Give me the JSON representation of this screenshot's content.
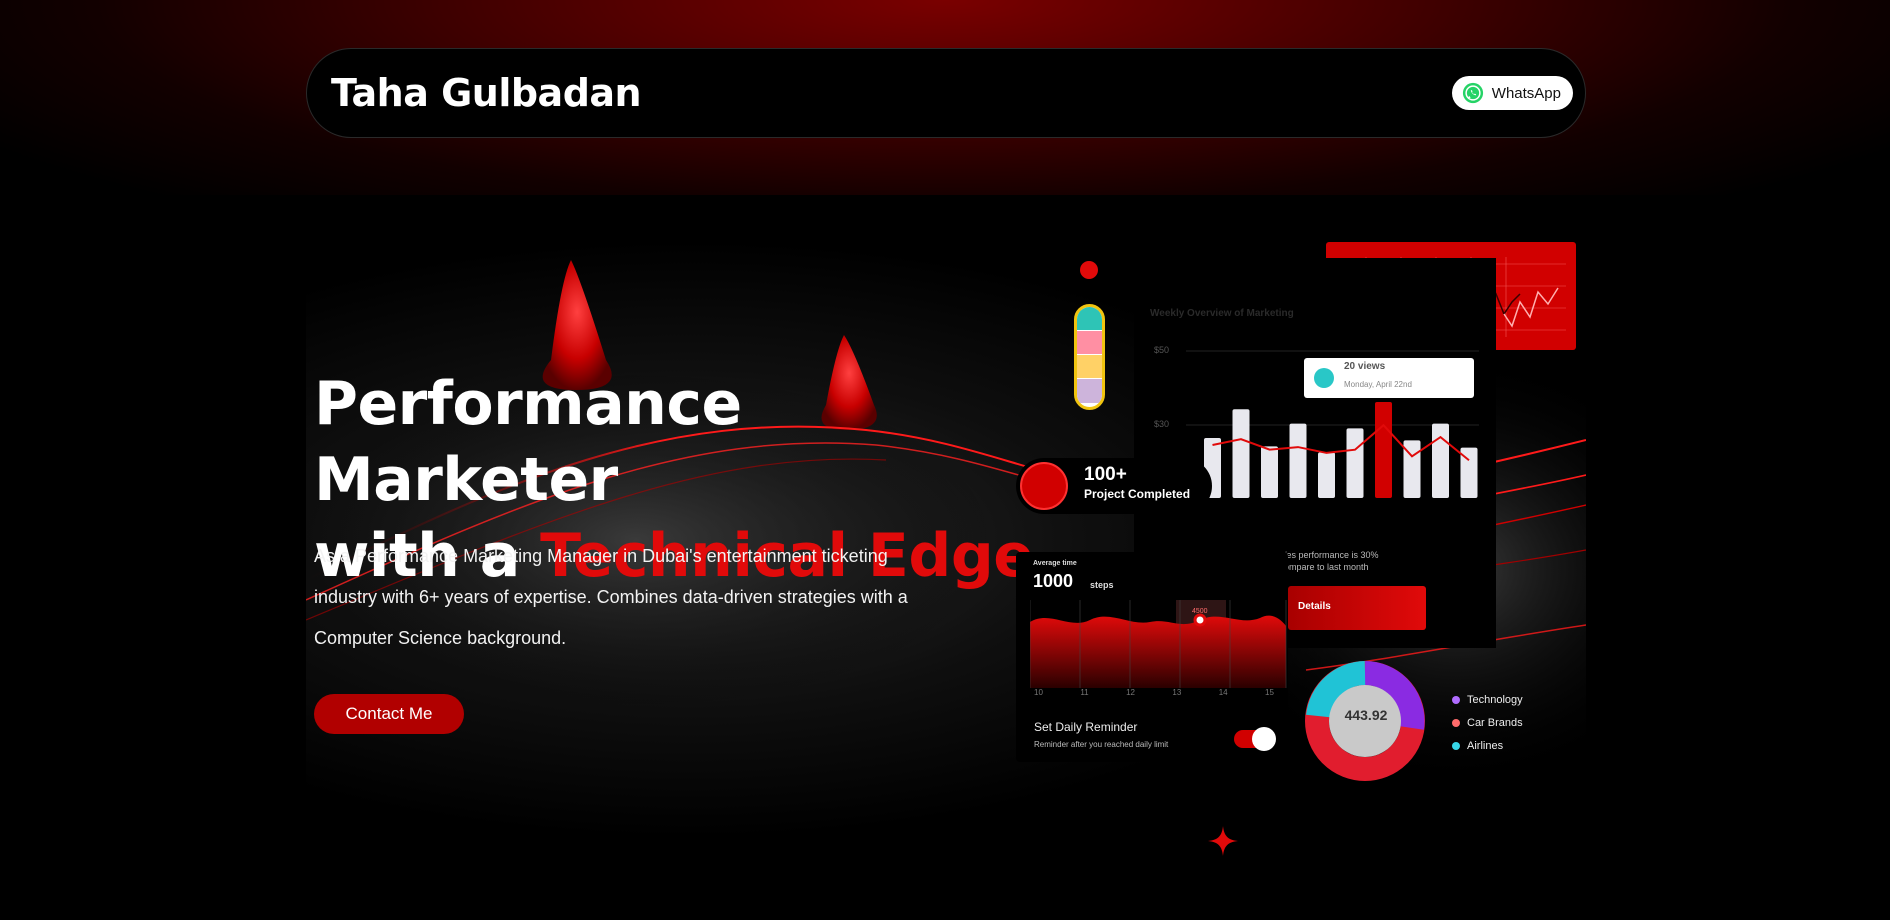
{
  "header": {
    "brand": "Taha Gulbadan",
    "whatsapp_label": "WhatsApp"
  },
  "hero": {
    "headline_line1": "Performance Marketer",
    "headline_line2_prefix": "with a ",
    "headline_line2_accent": "Technical Edge",
    "description": "As a Performance Marketing Manager in Dubai's entertainment ticketing industry with 6+ years of expertise. Combines data-driven strategies with a Computer Science background.",
    "cta_label": "Contact Me"
  },
  "dashboard": {
    "projects": {
      "count": "100+",
      "label": "Project Completed"
    },
    "weekly": {
      "title": "Weekly Overview of Marketing",
      "y_labels": [
        "$50",
        "$30"
      ],
      "tooltip_value": "20 views",
      "tooltip_date": "Monday, April 22nd",
      "perf_line1": "/es performance is 30%",
      "perf_line2": "ompare to last month",
      "details_label": "Details",
      "bar_values": [
        0.5,
        0.74,
        0.43,
        0.62,
        0.38,
        0.58,
        0.8,
        0.48,
        0.62,
        0.42
      ],
      "highlight_index": 6
    },
    "steps": {
      "caption": "Average time",
      "value": "1000",
      "unit": "steps",
      "marker": "4500",
      "x_labels": [
        "10",
        "11",
        "12",
        "13",
        "14",
        "15"
      ],
      "reminder_title": "Set Daily Reminder",
      "reminder_sub": "Reminder after you reached daily limit"
    },
    "donut": {
      "value": "443.92",
      "legend": [
        {
          "label": "Technology",
          "color": "#b06cff"
        },
        {
          "label": "Car Brands",
          "color": "#ff6b6b"
        },
        {
          "label": "Airlines",
          "color": "#36d6e7"
        }
      ]
    }
  },
  "colors": {
    "accent": "#e10a0a",
    "button": "#b10000",
    "background": "#000000"
  }
}
